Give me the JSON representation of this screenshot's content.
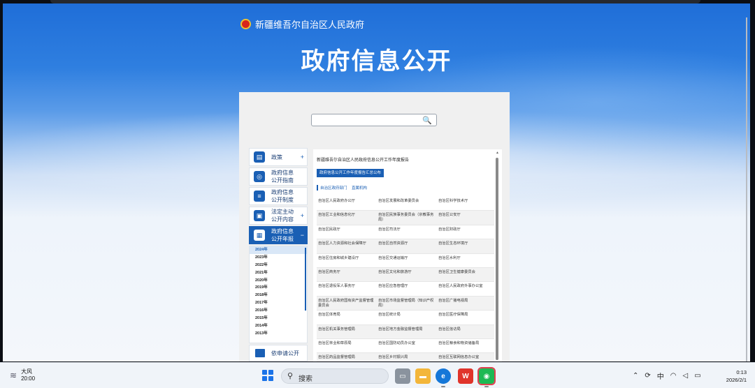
{
  "site": {
    "brand": "新疆维吾尔自治区人民政府",
    "hero_title": "政府信息公开"
  },
  "sidebar": {
    "items": [
      {
        "label": "政策",
        "icon": "document-icon",
        "expandable": true
      },
      {
        "label": "政府信息公开指南",
        "icon": "compass-icon",
        "expandable": false
      },
      {
        "label": "政府信息公开制度",
        "icon": "list-icon",
        "expandable": false
      },
      {
        "label": "法定主动公开内容",
        "icon": "file-icon",
        "expandable": true
      },
      {
        "label": "政府信息公开年报",
        "icon": "report-icon",
        "expandable": true,
        "active": true
      }
    ],
    "collapse_symbol": "−",
    "expand_symbol": "+",
    "years": [
      "2024年",
      "2023年",
      "2022年",
      "2021年",
      "2020年",
      "2019年",
      "2018年",
      "2017年",
      "2016年",
      "2015年",
      "2014年",
      "2013年"
    ],
    "selected_year": "2024年",
    "bottom_item": "依申请公开"
  },
  "content": {
    "title": "新疆维吾尔自治区人民政府信息公开工作年度报告",
    "button": "政府信息公开工作年度报告汇总公布",
    "tabs": [
      "自治区政府部门",
      "直属机构"
    ],
    "departments": [
      "自治区人民政府办公厅",
      "自治区发展和改革委员会",
      "自治区科学技术厅",
      "自治区工业和信息化厅",
      "自治区民族事务委员会（宗教事务局）",
      "自治区公安厅",
      "自治区民政厅",
      "自治区司法厅",
      "自治区财政厅",
      "自治区人力资源和社会保障厅",
      "自治区自然资源厅",
      "自治区生态环境厅",
      "自治区住房和城乡建设厅",
      "自治区交通运输厅",
      "自治区水利厅",
      "自治区商务厅",
      "自治区文化和旅游厅",
      "自治区卫生健康委员会",
      "自治区退役军人事务厅",
      "自治区应急管理厅",
      "自治区人民政府外事办公室",
      "自治区人民政府国有资产监督管理委员会",
      "自治区市场监督管理局（知识产权局）",
      "自治区广播电视局",
      "自治区体育局",
      "自治区统计局",
      "自治区医疗保障局",
      "自治区机关事务管理局",
      "自治区地方金融监督管理局",
      "自治区信访局",
      "自治区林业和草原局",
      "自治区国防动员办公室",
      "自治区粮食和物资储备局",
      "自治区药品监督管理局",
      "自治区乡村振兴局",
      "自治区互联网信息办公室"
    ]
  },
  "taskbar": {
    "weather_label": "大风",
    "weather_time": "20:00",
    "search_placeholder": "搜索",
    "ime": "中",
    "time": "0:13",
    "date": "2026/2/1",
    "apps": [
      "file-explorer",
      "folder",
      "edge",
      "wps",
      "wechat"
    ]
  },
  "colors": {
    "accent": "#1a5fb4",
    "hero_top": "#1f6ed8"
  }
}
